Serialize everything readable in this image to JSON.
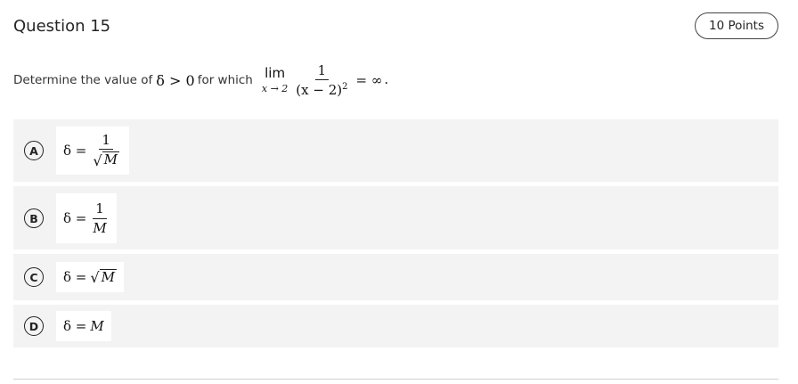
{
  "question": {
    "title": "Question 15",
    "points": "10 Points",
    "prompt_before": "Determine the value of",
    "delta_condition": "δ > 0",
    "prompt_middle": "for which",
    "lim_word": "lim",
    "lim_sub": "x → 2",
    "frac_num": "1",
    "frac_den_base": "(x − 2)",
    "frac_den_exp": "2",
    "equals_infinity": "= ∞",
    "prompt_end": "."
  },
  "options": [
    {
      "letter": "A",
      "lhs": "δ =",
      "num": "1",
      "sqrt_symbol": "√",
      "var": "M"
    },
    {
      "letter": "B",
      "lhs": "δ =",
      "num": "1",
      "var": "M"
    },
    {
      "letter": "C",
      "lhs": "δ =",
      "sqrt_symbol": "√",
      "var": "M"
    },
    {
      "letter": "D",
      "lhs": "δ =",
      "var": "M"
    }
  ],
  "colors": {
    "option_background": "#f3f3f3",
    "math_box_background": "#ffffff",
    "text": "#333333",
    "divider": "#cfcfcf"
  }
}
